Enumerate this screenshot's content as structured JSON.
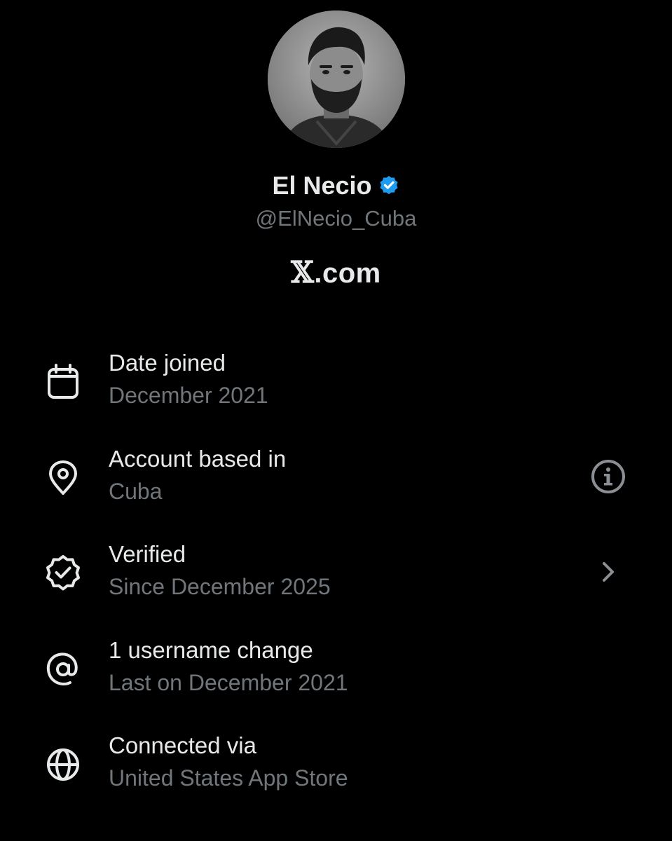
{
  "profile": {
    "display_name": "El Necio",
    "handle": "@ElNecio_Cuba",
    "verified_icon": "verified-badge-icon",
    "badge_color": "#1d9bf0"
  },
  "brand": {
    "x_glyph": "𝕏",
    "text": ".com"
  },
  "rows": [
    {
      "icon": "calendar-icon",
      "title": "Date joined",
      "subtitle": "December 2021",
      "trailing": ""
    },
    {
      "icon": "location-pin-icon",
      "title": "Account based in",
      "subtitle": "Cuba",
      "trailing": "info-icon"
    },
    {
      "icon": "verified-outline-icon",
      "title": "Verified",
      "subtitle": "Since December 2025",
      "trailing": "chevron-right-icon"
    },
    {
      "icon": "at-sign-icon",
      "title": "1 username change",
      "subtitle": "Last on December 2021",
      "trailing": ""
    },
    {
      "icon": "globe-icon",
      "title": "Connected via",
      "subtitle": "United States App Store",
      "trailing": ""
    }
  ],
  "colors": {
    "background": "#000000",
    "primary_text": "#e7e9ea",
    "secondary_text": "#71767b"
  }
}
